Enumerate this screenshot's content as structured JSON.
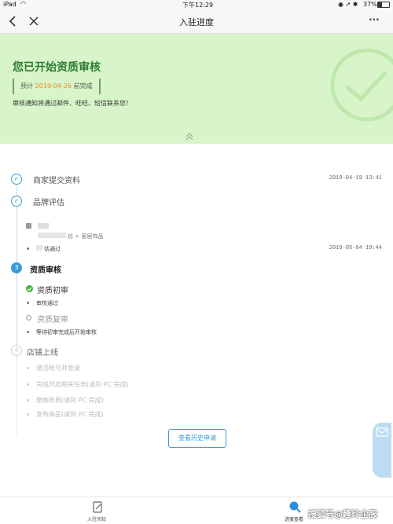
{
  "status_bar": {
    "device": "iPad",
    "time": "下午12:29",
    "battery": "37%"
  },
  "nav": {
    "title": "入驻进度",
    "more": "···"
  },
  "banner": {
    "title": "您已开始资质审核",
    "deadline_prefix": "预计",
    "deadline_date": "2019-04-26",
    "deadline_suffix": "前完成",
    "notice": "审核通知将通过邮件、旺旺、短信联系您！"
  },
  "steps": [
    {
      "label": "商家提交资料",
      "time": "2019-04-19 13:41",
      "state": "done"
    },
    {
      "label": "品牌评估",
      "state": "done",
      "category": "坊 > 家居饰品",
      "result": "估通过",
      "result_time": "2019-05-04 19:44"
    },
    {
      "number": "3",
      "label": "资质审核",
      "state": "current",
      "substeps": [
        {
          "label": "资质初审",
          "status": "审核通过"
        },
        {
          "label": "资质复审",
          "status": "等待初审完成后开始审核"
        }
      ]
    },
    {
      "number": "4",
      "label": "店铺上线",
      "state": "pending",
      "tasks": [
        "激活帐号并登录",
        "完成开店相关任务(请到 PC 完成)",
        "缴纳年费(请到 PC 完成)",
        "发布商品(请到 PC 完成)"
      ]
    }
  ],
  "history_button": "查看历史申请",
  "float_service": "",
  "tabs": [
    {
      "label": "入驻须知"
    },
    {
      "label": "进度查看"
    }
  ],
  "watermark": "搜狐号@趣玲企服",
  "colors": {
    "accent": "#3a9ad9",
    "banner_bg": "#d7f5c9",
    "title_green": "#2e7d32",
    "deadline_orange": "#f08a1a"
  }
}
